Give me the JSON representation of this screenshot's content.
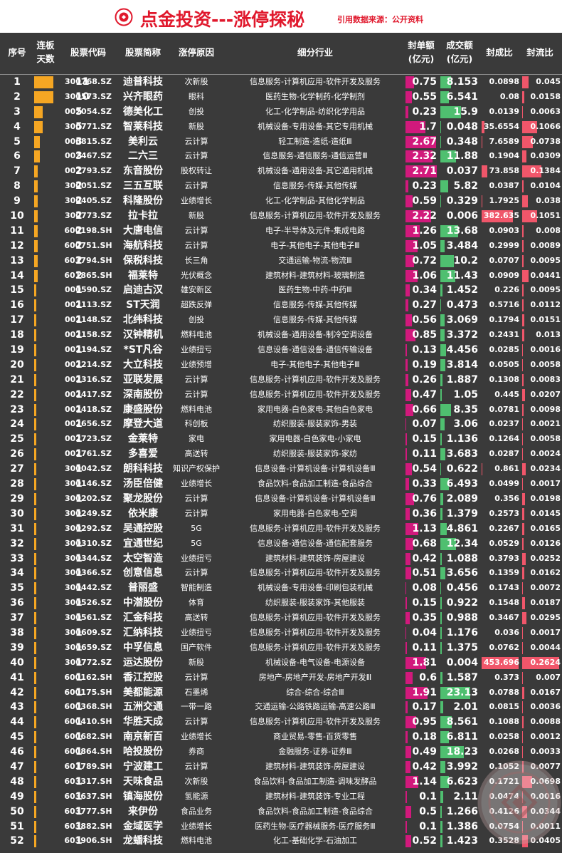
{
  "header": {
    "title": "点金投资---涨停探秘",
    "source": "引用数据来源：公开资料"
  },
  "columns": {
    "index": "序号",
    "days": "连板\n天数",
    "code": "股票代码",
    "name": "股票简称",
    "reason": "涨停原因",
    "industry": "细分行业",
    "seal_amount": "封单额\n(亿元)",
    "turnover": "成交额\n(亿元)",
    "seal_ratio": "封成比",
    "seal_float": "封流比"
  },
  "colors": {
    "days_bar": "#f5a623",
    "seal_bar": "#d1197c",
    "turnover_bar": "#4fbf70",
    "ratio_bar": "#f0566a",
    "title": "#e0182c"
  },
  "rows": [
    {
      "idx": "1",
      "days": "11",
      "code": "300768.SZ",
      "name": "迪普科技",
      "reason": "次新股",
      "industry": "信息服务-计算机应用-软件开发及服务",
      "seal": "0.75",
      "amt": "8.153",
      "ratio": "0.0898",
      "flow": "0.045"
    },
    {
      "idx": "2",
      "days": "10",
      "code": "300573.SZ",
      "name": "兴齐眼药",
      "reason": "眼科",
      "industry": "医药生物-化学制药-化学制剂",
      "seal": "0.55",
      "amt": "6.541",
      "ratio": "0.08",
      "flow": "0.0158"
    },
    {
      "idx": "3",
      "days": "5",
      "code": "002054.SZ",
      "name": "德美化工",
      "reason": "创投",
      "industry": "化工-化学制品-纺织化学用品",
      "seal": "0.23",
      "amt": "15.9",
      "ratio": "0.0139",
      "flow": "0.0063"
    },
    {
      "idx": "4",
      "days": "5",
      "code": "300771.SZ",
      "name": "智莱科技",
      "reason": "新股",
      "industry": "机械设备-专用设备-其它专用机械",
      "seal": "1.7",
      "amt": "0.048",
      "ratio": "35.6554",
      "flow": "0.1066"
    },
    {
      "idx": "5",
      "days": "3",
      "code": "000815.SZ",
      "name": "美利云",
      "reason": "云计算",
      "industry": "轻工制造-造纸-造纸Ⅲ",
      "seal": "2.67",
      "amt": "0.348",
      "ratio": "7.6589",
      "flow": "0.0738"
    },
    {
      "idx": "6",
      "days": "3",
      "code": "002467.SZ",
      "name": "二六三",
      "reason": "云计算",
      "industry": "信息服务-通信服务-通信运营Ⅲ",
      "seal": "2.32",
      "amt": "11.88",
      "ratio": "0.1904",
      "flow": "0.0309"
    },
    {
      "idx": "7",
      "days": "2",
      "code": "002793.SZ",
      "name": "东音股份",
      "reason": "股权转让",
      "industry": "机械设备-通用设备-其它通用机械",
      "seal": "2.71",
      "amt": "0.037",
      "ratio": "73.858",
      "flow": "0.1384"
    },
    {
      "idx": "8",
      "days": "2",
      "code": "300051.SZ",
      "name": "三五互联",
      "reason": "云计算",
      "industry": "信息服务-传媒-其他传媒",
      "seal": "0.23",
      "amt": "5.82",
      "ratio": "0.0387",
      "flow": "0.0104"
    },
    {
      "idx": "9",
      "days": "2",
      "code": "300405.SZ",
      "name": "科隆股份",
      "reason": "业绩增长",
      "industry": "化工-化学制品-其他化学制品",
      "seal": "0.59",
      "amt": "0.329",
      "ratio": "1.7925",
      "flow": "0.038"
    },
    {
      "idx": "10",
      "days": "2",
      "code": "300773.SZ",
      "name": "拉卡拉",
      "reason": "新股",
      "industry": "信息服务-计算机应用-软件开发及服务",
      "seal": "2.22",
      "amt": "0.006",
      "ratio": "382.635",
      "flow": "0.1051"
    },
    {
      "idx": "11",
      "days": "2",
      "code": "600198.SH",
      "name": "大唐电信",
      "reason": "云计算",
      "industry": "电子-半导体及元件-集成电路",
      "seal": "1.26",
      "amt": "13.68",
      "ratio": "0.0903",
      "flow": "0.008"
    },
    {
      "idx": "12",
      "days": "2",
      "code": "600751.SH",
      "name": "海航科技",
      "reason": "云计算",
      "industry": "电子-其他电子-其他电子Ⅲ",
      "seal": "1.05",
      "amt": "3.484",
      "ratio": "0.2999",
      "flow": "0.0089"
    },
    {
      "idx": "13",
      "days": "2",
      "code": "603794.SH",
      "name": "保税科技",
      "reason": "长三角",
      "industry": "交通运输-物流-物流Ⅲ",
      "seal": "0.72",
      "amt": "10.2",
      "ratio": "0.0707",
      "flow": "0.0095"
    },
    {
      "idx": "14",
      "days": "2",
      "code": "601865.SH",
      "name": "福莱特",
      "reason": "光伏概念",
      "industry": "建筑材料-建筑材料-玻璃制造",
      "seal": "1.06",
      "amt": "11.43",
      "ratio": "0.0909",
      "flow": "0.0441"
    },
    {
      "idx": "15",
      "days": "1",
      "code": "000590.SZ",
      "name": "启迪古汉",
      "reason": "雄安新区",
      "industry": "医药生物-中药-中药Ⅲ",
      "seal": "0.34",
      "amt": "1.452",
      "ratio": "0.226",
      "flow": "0.0095"
    },
    {
      "idx": "16",
      "days": "1",
      "code": "002113.SZ",
      "name": "ST天润",
      "reason": "超跌反弹",
      "industry": "信息服务-传媒-其他传媒",
      "seal": "0.27",
      "amt": "0.473",
      "ratio": "0.5716",
      "flow": "0.0112"
    },
    {
      "idx": "17",
      "days": "1",
      "code": "002148.SZ",
      "name": "北纬科技",
      "reason": "创投",
      "industry": "信息服务-传媒-其他传媒",
      "seal": "0.56",
      "amt": "3.069",
      "ratio": "0.1794",
      "flow": "0.0151"
    },
    {
      "idx": "18",
      "days": "1",
      "code": "002158.SZ",
      "name": "汉钟精机",
      "reason": "燃料电池",
      "industry": "机械设备-通用设备-制冷空调设备",
      "seal": "0.85",
      "amt": "3.372",
      "ratio": "0.2431",
      "flow": "0.013"
    },
    {
      "idx": "19",
      "days": "1",
      "code": "002194.SZ",
      "name": "*ST凡谷",
      "reason": "业绩扭亏",
      "industry": "信息设备-通信设备-通信传输设备",
      "seal": "0.13",
      "amt": "4.456",
      "ratio": "0.0285",
      "flow": "0.0016"
    },
    {
      "idx": "20",
      "days": "1",
      "code": "002214.SZ",
      "name": "大立科技",
      "reason": "业绩预增",
      "industry": "电子-其他电子-其他电子Ⅲ",
      "seal": "0.19",
      "amt": "3.814",
      "ratio": "0.0505",
      "flow": "0.0058"
    },
    {
      "idx": "21",
      "days": "1",
      "code": "002316.SZ",
      "name": "亚联发展",
      "reason": "云计算",
      "industry": "信息服务-计算机应用-软件开发及服务",
      "seal": "0.26",
      "amt": "1.887",
      "ratio": "0.1308",
      "flow": "0.0083"
    },
    {
      "idx": "22",
      "days": "1",
      "code": "002417.SZ",
      "name": "深南股份",
      "reason": "云计算",
      "industry": "信息服务-计算机应用-软件开发及服务",
      "seal": "0.47",
      "amt": "1.05",
      "ratio": "0.445",
      "flow": "0.0207"
    },
    {
      "idx": "23",
      "days": "1",
      "code": "002418.SZ",
      "name": "康盛股份",
      "reason": "燃料电池",
      "industry": "家用电器-白色家电-其他白色家电",
      "seal": "0.66",
      "amt": "8.35",
      "ratio": "0.0781",
      "flow": "0.0098"
    },
    {
      "idx": "24",
      "days": "1",
      "code": "002656.SZ",
      "name": "摩登大道",
      "reason": "科创板",
      "industry": "纺织服装-服装家饰-男装",
      "seal": "0.07",
      "amt": "3.06",
      "ratio": "0.0237",
      "flow": "0.0021"
    },
    {
      "idx": "25",
      "days": "1",
      "code": "002723.SZ",
      "name": "金莱特",
      "reason": "家电",
      "industry": "家用电器-白色家电-小家电",
      "seal": "0.15",
      "amt": "1.136",
      "ratio": "0.1264",
      "flow": "0.0058"
    },
    {
      "idx": "26",
      "days": "1",
      "code": "002761.SZ",
      "name": "多喜爱",
      "reason": "高送转",
      "industry": "纺织服装-服装家饰-家纺",
      "seal": "0.11",
      "amt": "3.683",
      "ratio": "0.0287",
      "flow": "0.0024"
    },
    {
      "idx": "27",
      "days": "1",
      "code": "300042.SZ",
      "name": "朗科科技",
      "reason": "知识产权保护",
      "industry": "信息设备-计算机设备-计算机设备Ⅲ",
      "seal": "0.54",
      "amt": "0.622",
      "ratio": "0.861",
      "flow": "0.0234"
    },
    {
      "idx": "28",
      "days": "1",
      "code": "300146.SZ",
      "name": "汤臣倍健",
      "reason": "业绩增长",
      "industry": "食品饮料-食品加工制造-食品综合",
      "seal": "0.33",
      "amt": "6.493",
      "ratio": "0.0499",
      "flow": "0.0017"
    },
    {
      "idx": "29",
      "days": "1",
      "code": "300202.SZ",
      "name": "聚龙股份",
      "reason": "云计算",
      "industry": "信息设备-计算机设备-计算机设备Ⅲ",
      "seal": "0.76",
      "amt": "2.089",
      "ratio": "0.356",
      "flow": "0.0198"
    },
    {
      "idx": "30",
      "days": "1",
      "code": "300249.SZ",
      "name": "依米康",
      "reason": "云计算",
      "industry": "家用电器-白色家电-空调",
      "seal": "0.36",
      "amt": "1.379",
      "ratio": "0.2573",
      "flow": "0.0145"
    },
    {
      "idx": "31",
      "days": "1",
      "code": "300292.SZ",
      "name": "吴通控股",
      "reason": "5G",
      "industry": "信息服务-计算机应用-软件开发及服务",
      "seal": "1.13",
      "amt": "4.861",
      "ratio": "0.2267",
      "flow": "0.0165"
    },
    {
      "idx": "32",
      "days": "1",
      "code": "300310.SZ",
      "name": "宜通世纪",
      "reason": "5G",
      "industry": "信息设备-通信设备-通信配套服务",
      "seal": "0.68",
      "amt": "12.34",
      "ratio": "0.0529",
      "flow": "0.0126"
    },
    {
      "idx": "33",
      "days": "1",
      "code": "300344.SZ",
      "name": "太空智造",
      "reason": "业绩扭亏",
      "industry": "建筑材料-建筑装饰-房屋建设",
      "seal": "0.42",
      "amt": "1.088",
      "ratio": "0.3793",
      "flow": "0.0252"
    },
    {
      "idx": "34",
      "days": "1",
      "code": "300366.SZ",
      "name": "创意信息",
      "reason": "云计算",
      "industry": "信息服务-计算机应用-软件开发及服务",
      "seal": "0.51",
      "amt": "3.656",
      "ratio": "0.1359",
      "flow": "0.0162"
    },
    {
      "idx": "35",
      "days": "1",
      "code": "300442.SZ",
      "name": "普丽盛",
      "reason": "智能制造",
      "industry": "机械设备-专用设备-印刷包装机械",
      "seal": "0.08",
      "amt": "0.456",
      "ratio": "0.1743",
      "flow": "0.0072"
    },
    {
      "idx": "36",
      "days": "1",
      "code": "300526.SZ",
      "name": "中潜股份",
      "reason": "体育",
      "industry": "纺织服装-服装家饰-其他服装",
      "seal": "0.15",
      "amt": "0.922",
      "ratio": "0.1548",
      "flow": "0.0187"
    },
    {
      "idx": "37",
      "days": "1",
      "code": "300561.SZ",
      "name": "汇金科技",
      "reason": "高送转",
      "industry": "信息服务-计算机应用-软件开发及服务",
      "seal": "0.35",
      "amt": "0.988",
      "ratio": "0.3467",
      "flow": "0.0295"
    },
    {
      "idx": "38",
      "days": "1",
      "code": "300609.SZ",
      "name": "汇纳科技",
      "reason": "业绩扭亏",
      "industry": "信息服务-计算机应用-软件开发及服务",
      "seal": "0.04",
      "amt": "1.176",
      "ratio": "0.036",
      "flow": "0.0017"
    },
    {
      "idx": "39",
      "days": "1",
      "code": "300659.SZ",
      "name": "中孚信息",
      "reason": "国产软件",
      "industry": "信息服务-计算机应用-软件开发及服务",
      "seal": "0.11",
      "amt": "1.375",
      "ratio": "0.0762",
      "flow": "0.0044"
    },
    {
      "idx": "40",
      "days": "1",
      "code": "300772.SZ",
      "name": "运达股份",
      "reason": "新股",
      "industry": "机械设备-电气设备-电源设备",
      "seal": "1.81",
      "amt": "0.004",
      "ratio": "453.696",
      "flow": "0.2624"
    },
    {
      "idx": "41",
      "days": "1",
      "code": "600162.SH",
      "name": "香江控股",
      "reason": "云计算",
      "industry": "房地产-房地产开发-房地产开发Ⅲ",
      "seal": "0.6",
      "amt": "1.587",
      "ratio": "0.373",
      "flow": "0.007"
    },
    {
      "idx": "42",
      "days": "1",
      "code": "600175.SH",
      "name": "美都能源",
      "reason": "石墨烯",
      "industry": "综合-综合-综合Ⅲ",
      "seal": "1.91",
      "amt": "23.13",
      "ratio": "0.0788",
      "flow": "0.0167"
    },
    {
      "idx": "43",
      "days": "1",
      "code": "600368.SH",
      "name": "五洲交通",
      "reason": "一带一路",
      "industry": "交通运输-公路铁路运输-高速公路Ⅲ",
      "seal": "0.17",
      "amt": "2.01",
      "ratio": "0.0815",
      "flow": "0.0036"
    },
    {
      "idx": "44",
      "days": "1",
      "code": "600410.SH",
      "name": "华胜天成",
      "reason": "云计算",
      "industry": "信息服务-计算机应用-软件开发及服务",
      "seal": "0.95",
      "amt": "8.561",
      "ratio": "0.1088",
      "flow": "0.0088"
    },
    {
      "idx": "45",
      "days": "1",
      "code": "600682.SH",
      "name": "南京新百",
      "reason": "业绩增长",
      "industry": "商业贸易-零售-百货零售",
      "seal": "0.18",
      "amt": "6.811",
      "ratio": "0.0258",
      "flow": "0.0012"
    },
    {
      "idx": "46",
      "days": "1",
      "code": "600864.SH",
      "name": "哈投股份",
      "reason": "券商",
      "industry": "金融服务-证券-证券Ⅲ",
      "seal": "0.49",
      "amt": "18.23",
      "ratio": "0.0268",
      "flow": "0.0033"
    },
    {
      "idx": "47",
      "days": "1",
      "code": "601789.SH",
      "name": "宁波建工",
      "reason": "云计算",
      "industry": "建筑材料-建筑装饰-房屋建设",
      "seal": "0.42",
      "amt": "3.992",
      "ratio": "0.1052",
      "flow": "0.0077"
    },
    {
      "idx": "48",
      "days": "1",
      "code": "603317.SH",
      "name": "天味食品",
      "reason": "次新股",
      "industry": "食品饮料-食品加工制造-调味发酵品",
      "seal": "1.14",
      "amt": "6.623",
      "ratio": "0.1721",
      "flow": "0.0698"
    },
    {
      "idx": "49",
      "days": "1",
      "code": "603637.SH",
      "name": "镇海股份",
      "reason": "氢能源",
      "industry": "建筑材料-建筑装饰-专业工程",
      "seal": "0.1",
      "amt": "2.11",
      "ratio": "0.0474",
      "flow": "0.0016"
    },
    {
      "idx": "50",
      "days": "1",
      "code": "603777.SH",
      "name": "来伊份",
      "reason": "食品业务",
      "industry": "食品饮料-食品加工制造-食品综合",
      "seal": "0.5",
      "amt": "1.266",
      "ratio": "0.4126",
      "flow": "0.0344"
    },
    {
      "idx": "51",
      "days": "1",
      "code": "603882.SH",
      "name": "金域医学",
      "reason": "业绩增长",
      "industry": "医药生物-医疗器械服务-医疗服务Ⅲ",
      "seal": "0.1",
      "amt": "1.386",
      "ratio": "0.0754",
      "flow": "0.0011"
    },
    {
      "idx": "52",
      "days": "1",
      "code": "603906.SH",
      "name": "龙蟠科技",
      "reason": "燃料电池",
      "industry": "化工-基础化学-石油加工",
      "seal": "0.52",
      "amt": "1.423",
      "ratio": "0.3528",
      "flow": "0.0405"
    }
  ]
}
